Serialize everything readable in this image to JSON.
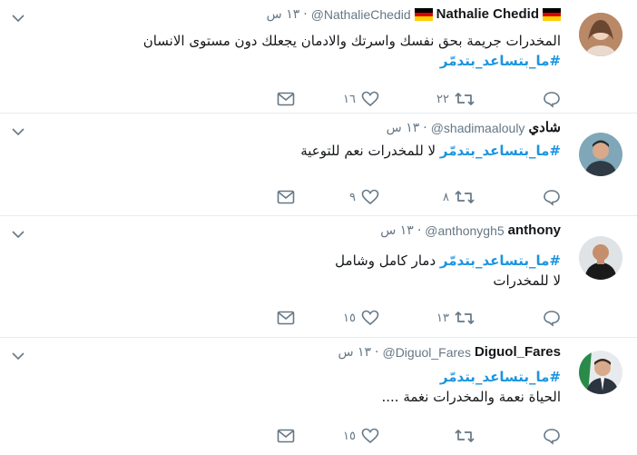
{
  "tweets": [
    {
      "name": "Nathalie Chedid",
      "handle": "@NathalieChedid",
      "time": "١٣ س",
      "flags": true,
      "line1": "المخدرات جريمة بحق نفسك واسرتك والادمان يجعلك دون مستوى الانسان",
      "hashtag": "#ما_بتساعد_بتدمّر",
      "rest": "",
      "line3": "",
      "retweets": "٢٢",
      "likes": "١٦"
    },
    {
      "name": "شادي",
      "handle": "@shadimaalouly",
      "time": "١٣ س",
      "flags": false,
      "hashtag": "#ما_بتساعد_بتدمّر",
      "rest": "لا للمخدرات نعم للتوعية",
      "retweets": "٨",
      "likes": "٩"
    },
    {
      "name": "anthony",
      "handle": "@anthonygh5",
      "time": "١٣ س",
      "flags": false,
      "hashtag": "#ما_بتساعد_بتدمّر",
      "rest": "دمار كامل وشامل",
      "line3": "لا للمخدرات",
      "retweets": "١٣",
      "likes": "١٥"
    },
    {
      "name": "Diguol_Fares",
      "handle": "@Diguol_Fares",
      "time": "١٣ س",
      "flags": false,
      "hashtag": "#ما_بتساعد_بتدمّر",
      "rest": "",
      "line3": "الحياة نعمة والمخدرات نغمة ....",
      "retweets": "",
      "likes": "١٥"
    }
  ],
  "colors": {
    "accent": "#1b95e0",
    "muted": "#657786",
    "divider": "#e6ecf0"
  },
  "icons": [
    "chevron-down-icon",
    "reply-icon",
    "retweet-icon",
    "like-icon",
    "direct-message-icon"
  ]
}
